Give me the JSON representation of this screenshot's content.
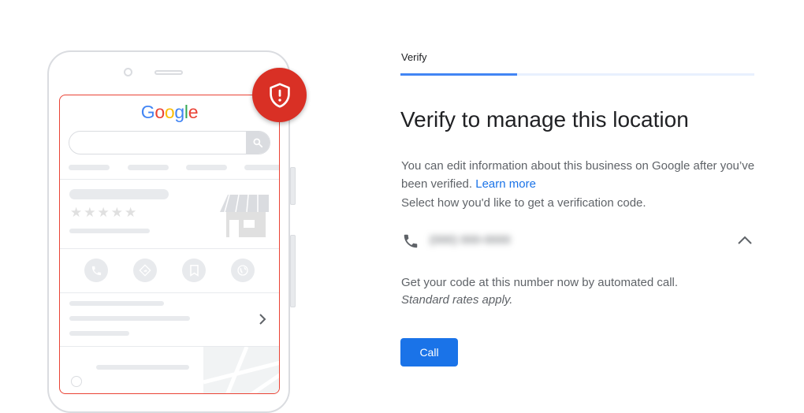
{
  "illustration": {
    "logo_letters": [
      {
        "char": "G",
        "color": "#4285f4"
      },
      {
        "char": "o",
        "color": "#ea4335"
      },
      {
        "char": "o",
        "color": "#fbbc05"
      },
      {
        "char": "g",
        "color": "#4285f4"
      },
      {
        "char": "l",
        "color": "#34a853"
      },
      {
        "char": "e",
        "color": "#ea4335"
      }
    ],
    "stars": "★★★★★",
    "badge_icon": "shield-alert-icon",
    "action_icons": [
      "phone-icon",
      "directions-icon",
      "bookmark-icon",
      "globe-icon"
    ],
    "colors": {
      "badge": "#d93025",
      "screen_border": "#ea4335",
      "skeleton": "#e8eaed"
    }
  },
  "stepper": {
    "label": "Verify",
    "progress": 0.33,
    "accent": "#4285f4"
  },
  "main": {
    "title": "Verify to manage this location",
    "description": "You can edit information about this business on Google after you’ve been verified.",
    "learn_more": "Learn more",
    "select_prompt": "Select how you'd like to get a verification code.",
    "method": {
      "icon": "phone-icon",
      "number": "(000) 000-0000",
      "expand_icon": "chevron-up-icon"
    },
    "info_line1": "Get your code at this number now by automated call.",
    "info_line2": "Standard rates apply.",
    "call_button": "Call",
    "button_color": "#1a73e8"
  }
}
